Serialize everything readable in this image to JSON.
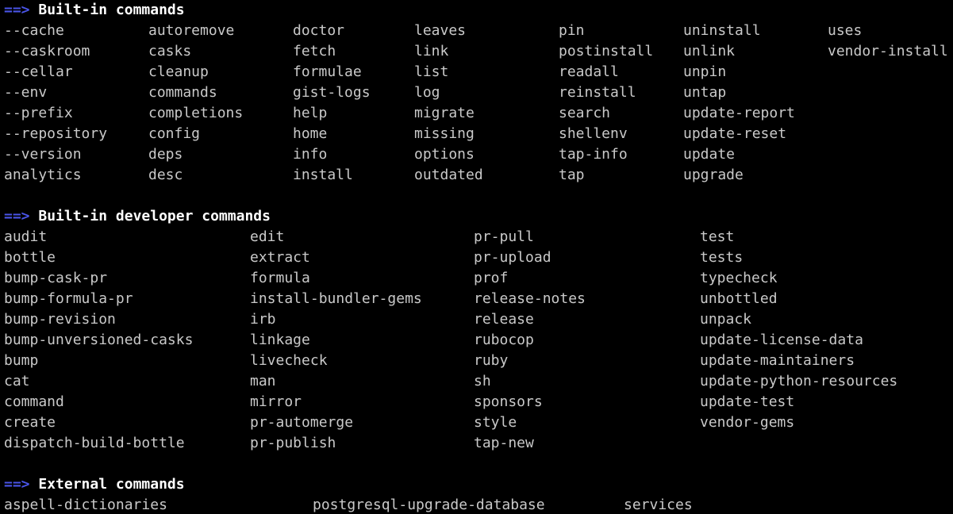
{
  "terminal": {
    "sections": [
      {
        "arrow": "==>",
        "title": "Built-in commands",
        "rows": [
          [
            "--cache",
            "autoremove",
            "doctor",
            "leaves",
            "pin",
            "uninstall",
            "uses"
          ],
          [
            "--caskroom",
            "casks",
            "fetch",
            "link",
            "postinstall",
            "unlink",
            "vendor-install"
          ],
          [
            "--cellar",
            "cleanup",
            "formulae",
            "list",
            "readall",
            "unpin",
            ""
          ],
          [
            "--env",
            "commands",
            "gist-logs",
            "log",
            "reinstall",
            "untap",
            ""
          ],
          [
            "--prefix",
            "completions",
            "help",
            "migrate",
            "search",
            "update-report",
            ""
          ],
          [
            "--repository",
            "config",
            "home",
            "missing",
            "shellenv",
            "update-reset",
            ""
          ],
          [
            "--version",
            "deps",
            "info",
            "options",
            "tap-info",
            "update",
            ""
          ],
          [
            "analytics",
            "desc",
            "install",
            "outdated",
            "tap",
            "upgrade",
            ""
          ]
        ]
      },
      {
        "arrow": "==>",
        "title": "Built-in developer commands",
        "rows": [
          [
            "audit",
            "edit",
            "pr-pull",
            "test"
          ],
          [
            "bottle",
            "extract",
            "pr-upload",
            "tests"
          ],
          [
            "bump-cask-pr",
            "formula",
            "prof",
            "typecheck"
          ],
          [
            "bump-formula-pr",
            "install-bundler-gems",
            "release-notes",
            "unbottled"
          ],
          [
            "bump-revision",
            "irb",
            "release",
            "unpack"
          ],
          [
            "bump-unversioned-casks",
            "linkage",
            "rubocop",
            "update-license-data"
          ],
          [
            "bump",
            "livecheck",
            "ruby",
            "update-maintainers"
          ],
          [
            "cat",
            "man",
            "sh",
            "update-python-resources"
          ],
          [
            "command",
            "mirror",
            "sponsors",
            "update-test"
          ],
          [
            "create",
            "pr-automerge",
            "style",
            "vendor-gems"
          ],
          [
            "dispatch-build-bottle",
            "pr-publish",
            "tap-new",
            ""
          ]
        ]
      },
      {
        "arrow": "==>",
        "title": "External commands",
        "rows": [
          [
            "aspell-dictionaries",
            "postgresql-upgrade-database",
            "services"
          ]
        ]
      }
    ]
  },
  "colors": {
    "background": "#000000",
    "text": "#c9c9c9",
    "arrow": "#4a55e8",
    "heading": "#ffffff"
  }
}
